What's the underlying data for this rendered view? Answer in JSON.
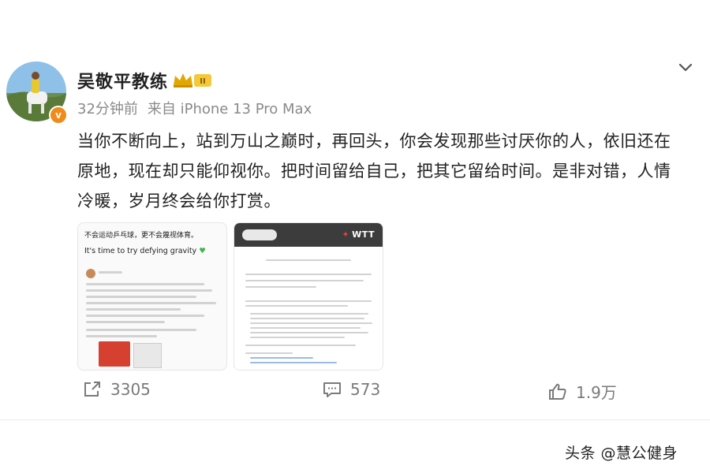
{
  "post": {
    "author": "吴敬平教练",
    "time": "32分钟前",
    "source": "来自 iPhone 13 Pro Max",
    "text": "当你不断向上，站到万山之巅时，再回头，你会发现那些讨厌你的人，依旧还在原地，现在却只能仰视你。把时间留给自己，把其它留给时间。是非对错，人情冷暖，岁月终会给你打赏。",
    "verified_badge": "v",
    "crown_label": "II"
  },
  "images": [
    {
      "line1": "不会运动乒乓球，更不会蔑视体育。",
      "line2": "It's time to try defying gravity"
    },
    {
      "logo_left": "",
      "logo_right": "WTT"
    }
  ],
  "actions": {
    "share_count": "3305",
    "comment_count": "573",
    "like_count": "1.9万"
  },
  "watermark": "头条 @慧公健身",
  "icons": {
    "share": "share-icon",
    "comment": "comment-icon",
    "like": "thumbs-up-icon",
    "more": "chevron-down-icon",
    "crown": "crown-icon"
  },
  "colors": {
    "badge": "#f08a1a",
    "meta_text": "#8a8a8a",
    "action_text": "#7a7a7a"
  }
}
